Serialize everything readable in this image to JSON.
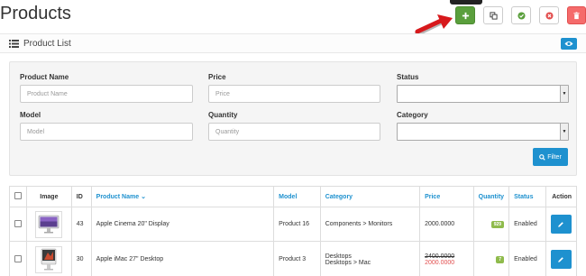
{
  "header": {
    "title": "Products",
    "accent_add": "#5a9f3c",
    "accent_primary": "#1e91cf",
    "accent_danger": "#f56b6b"
  },
  "panel": {
    "title": "Product List"
  },
  "filter": {
    "product_name": {
      "label": "Product Name",
      "placeholder": "Product Name"
    },
    "price": {
      "label": "Price",
      "placeholder": "Price"
    },
    "status": {
      "label": "Status",
      "value": ""
    },
    "model": {
      "label": "Model",
      "placeholder": "Model"
    },
    "quantity": {
      "label": "Quantity",
      "placeholder": "Quantity"
    },
    "category": {
      "label": "Category",
      "value": ""
    },
    "button_label": "Filter"
  },
  "table": {
    "columns": {
      "image": "Image",
      "id": "ID",
      "product_name": "Product Name",
      "model": "Model",
      "category": "Category",
      "price": "Price",
      "quantity": "Quantity",
      "status": "Status",
      "action": "Action"
    },
    "rows": [
      {
        "id": "43",
        "name": "Apple Cinema 20\" Display",
        "model": "Product 16",
        "category_1": "Components  >  Monitors",
        "category_2": "",
        "price": "2000.0000",
        "special": "",
        "quantity": "929",
        "status": "Enabled"
      },
      {
        "id": "30",
        "name": "Apple iMac 27\" Desktop",
        "model": "Product 3",
        "category_1": "Desktops",
        "category_2": "Desktops  >  Mac",
        "price": "2400.0000",
        "special": "2000.0000",
        "quantity": "7",
        "status": "Enabled"
      }
    ]
  }
}
